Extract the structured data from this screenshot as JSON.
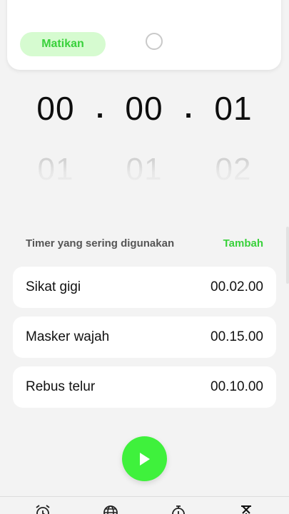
{
  "alarm_card": {
    "off_button_label": "Matikan"
  },
  "picker": {
    "current": {
      "hours": "00",
      "minutes": "00",
      "seconds": "01"
    },
    "next": {
      "hours": "01",
      "minutes": "01",
      "seconds": "02"
    },
    "separator": "."
  },
  "frequent_timers": {
    "title": "Timer yang sering digunakan",
    "add_label": "Tambah",
    "items": [
      {
        "name": "Sikat gigi",
        "duration": "00.02.00"
      },
      {
        "name": "Masker wajah",
        "duration": "00.15.00"
      },
      {
        "name": "Rebus telur",
        "duration": "00.10.00"
      }
    ]
  },
  "start_button": {
    "icon": "play-icon"
  },
  "bottom_nav": {
    "items": [
      {
        "icon": "alarm-clock-icon"
      },
      {
        "icon": "globe-icon"
      },
      {
        "icon": "stopwatch-icon"
      },
      {
        "icon": "hourglass-icon"
      }
    ]
  },
  "colors": {
    "accent": "#39d13b",
    "accent_button": "#3ff13c",
    "accent_soft": "#d6fbd0",
    "background": "#f3f3f3",
    "card": "#ffffff"
  }
}
